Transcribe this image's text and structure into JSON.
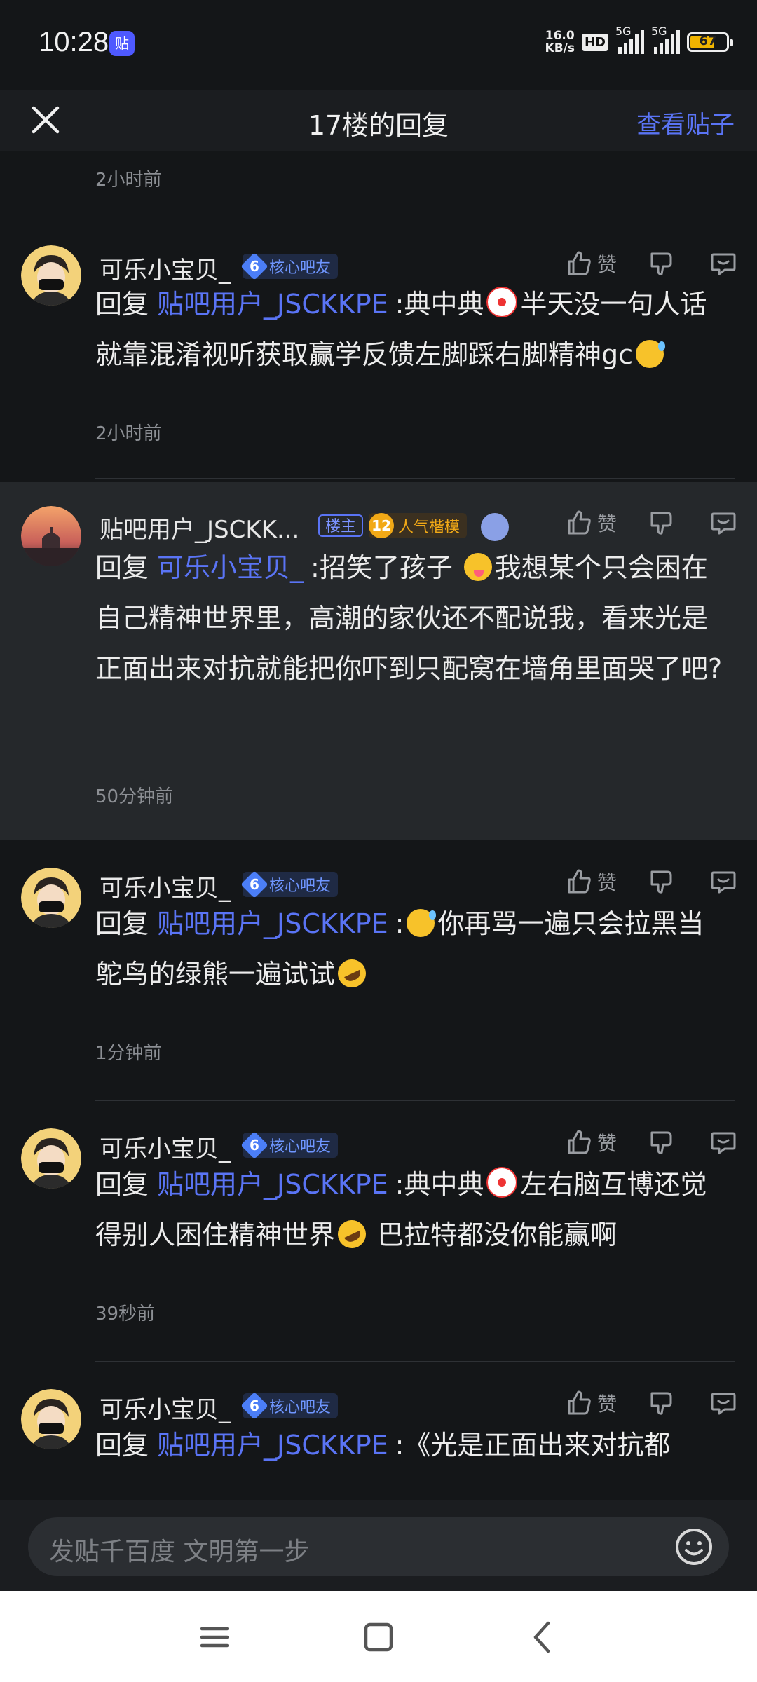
{
  "status": {
    "time": "10:28",
    "app_icon": "贴",
    "net_speed_top": "16.0",
    "net_speed_bottom": "KB/s",
    "hd": "HD",
    "sig1": "5G",
    "sig2": "5G",
    "battery": "67"
  },
  "header": {
    "title": "17楼的回复",
    "view_post": "查看贴子"
  },
  "feed": {
    "top_time": "2小时前",
    "like_label": "赞",
    "reply_kw": "回复",
    "comments": [
      {
        "user": "可乐小宝贝_",
        "level": "6",
        "badge": "核心吧友",
        "target": "贴吧用户_JSCKKPE",
        "text_a": ":典中典",
        "emoji_a": "clown",
        "text_b": "半天没一句人话就靠混淆视听获取赢学反馈左脚踩右脚精神gc",
        "emoji_b": "sweat",
        "text_c": "",
        "time": "2小时前"
      },
      {
        "user": "贴吧用户_JSCKK...",
        "owner_badge": "楼主",
        "level": "12",
        "badge": "人气楷模",
        "target": "可乐小宝贝_",
        "text_a": ":招笑了孩子 ",
        "emoji_a": "yum",
        "text_b": "我想某个只会困在自己精神世界里，高潮的家伙还不配说我，看来光是正面出来对抗就能把你吓到只配窝在墙角里面哭了吧?",
        "time": "50分钟前"
      },
      {
        "user": "可乐小宝贝_",
        "level": "6",
        "badge": "核心吧友",
        "target": "贴吧用户_JSCKKPE",
        "text_a": ":",
        "emoji_a": "sweat",
        "text_b": "你再骂一遍只会拉黑当鸵鸟的绿熊一遍试试",
        "emoji_b": "rofl",
        "time": "1分钟前"
      },
      {
        "user": "可乐小宝贝_",
        "level": "6",
        "badge": "核心吧友",
        "target": "贴吧用户_JSCKKPE",
        "text_a": ":典中典",
        "emoji_a": "clown",
        "text_b": "左右脑互博还觉得别人困住精神世界",
        "emoji_b": "rofl",
        "text_c": " 巴拉特都没你能赢啊",
        "time": "39秒前"
      },
      {
        "user": "可乐小宝贝_",
        "level": "6",
        "badge": "核心吧友",
        "target": "贴吧用户_JSCKKPE",
        "text_a": ":《光是正面出来对抗都",
        "time": ""
      }
    ]
  },
  "composer": {
    "placeholder": "发贴千百度 文明第一步"
  },
  "colors": {
    "accent": "#5a74f5",
    "background": "#141618",
    "highlight_row": "#25282b",
    "core_badge": "#4b7ef7",
    "popular_badge": "#f2a916"
  },
  "icons": [
    "close-icon",
    "like-icon",
    "dislike-icon",
    "reply-icon",
    "emoji-icon",
    "menu-icon",
    "home-icon",
    "back-icon"
  ]
}
